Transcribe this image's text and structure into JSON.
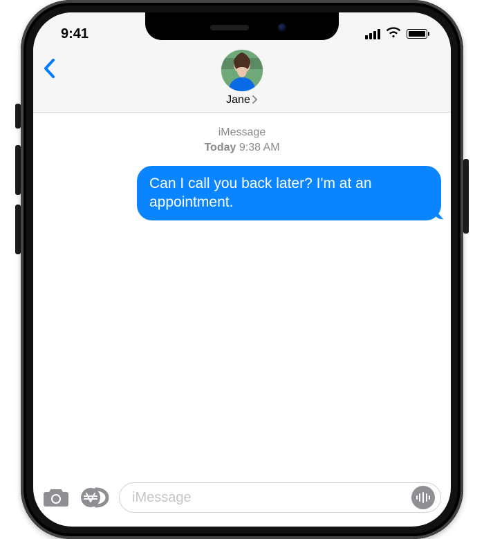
{
  "status": {
    "time": "9:41"
  },
  "header": {
    "contact_name": "Jane"
  },
  "thread": {
    "service_label": "iMessage",
    "timestamp_prefix": "Today",
    "timestamp_time": "9:38 AM",
    "messages": [
      {
        "side": "sent",
        "text": "Can I call you back later? I'm at an appointment."
      }
    ]
  },
  "compose": {
    "placeholder": "iMessage"
  },
  "colors": {
    "accent": "#007aff",
    "imessage_bubble": "#0a84ff",
    "secondary_text": "#8e8e93"
  }
}
